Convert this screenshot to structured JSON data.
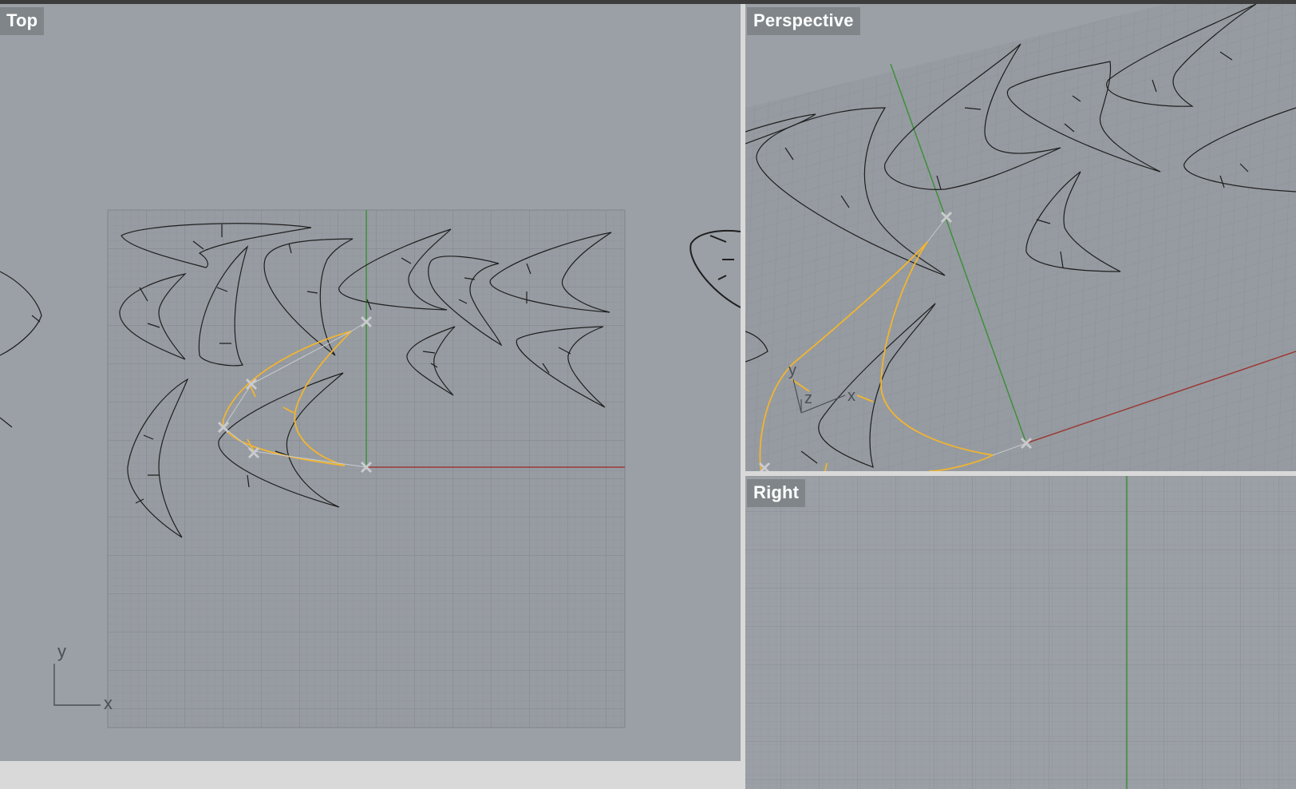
{
  "viewports": {
    "top": {
      "label": "Top"
    },
    "perspective": {
      "label": "Perspective"
    },
    "right": {
      "label": "Right"
    }
  },
  "axes": {
    "top": {
      "x": "x",
      "y": "y"
    },
    "perspective": {
      "x": "x",
      "y": "y",
      "z": "z"
    }
  },
  "colors": {
    "viewport_bg": "#9ba0a6",
    "grid_minor": "#8f949a",
    "grid_major": "#7e8389",
    "axis_x": "#9b3a35",
    "axis_y": "#3f8f3a",
    "selection": "#f2b52e",
    "curve": "#1e1e1e"
  },
  "icons": {
    "gumball_handle": "x-mark-icon"
  }
}
